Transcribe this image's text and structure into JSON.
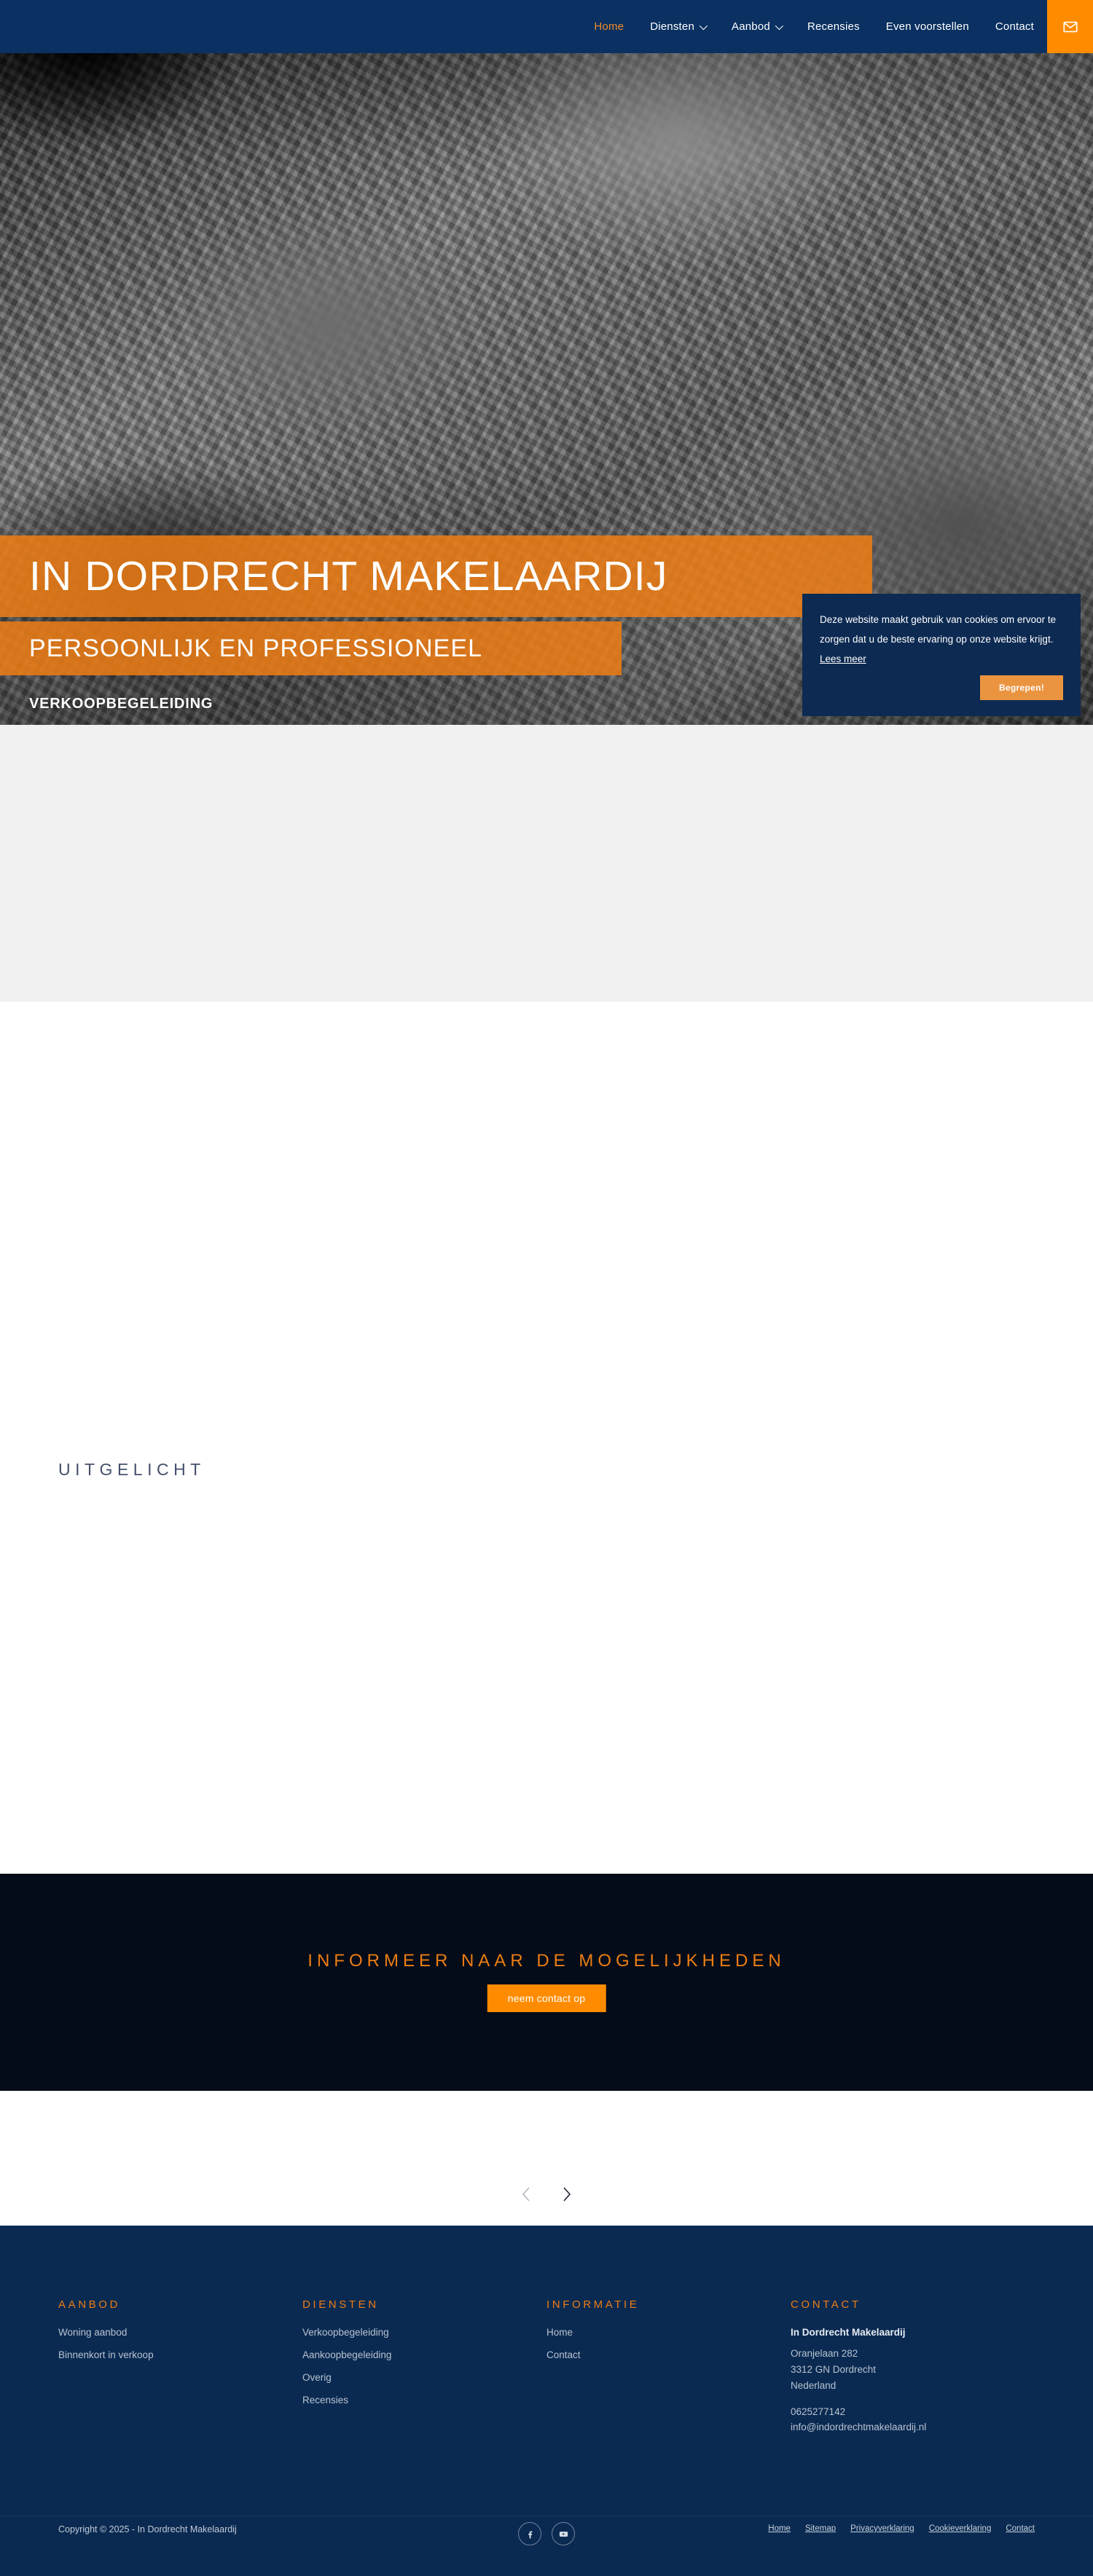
{
  "header": {
    "nav_items": [
      {
        "label": "Home",
        "active": true,
        "has_caret": false
      },
      {
        "label": "Diensten",
        "active": false,
        "has_caret": true
      },
      {
        "label": "Aanbod",
        "active": false,
        "has_caret": true
      },
      {
        "label": "Recensies",
        "active": false,
        "has_caret": false
      },
      {
        "label": "Even voorstellen",
        "active": false,
        "has_caret": false
      },
      {
        "label": "Contact",
        "active": false,
        "has_caret": false
      }
    ],
    "mail_icon": "mail-icon",
    "accent_color": "#ff8c00",
    "bar_color": "#0a3161"
  },
  "hero": {
    "title": "IN DORDRECHT MAKELAARDIJ",
    "subtitle": "PERSOONLIJK EN PROFESSIONEEL",
    "kicker": "VERKOOPBEGELEIDING",
    "bar_color": "#ed7d14"
  },
  "cookie": {
    "text": "Deze website maakt gebruik van cookies om ervoor te zorgen dat u de beste ervaring op onze website krijgt.",
    "link_label": "Lees meer",
    "button_label": "Begrepen!",
    "background": "#0c2a52",
    "button_color": "#eb9440"
  },
  "featured": {
    "heading": "UITGELICHT"
  },
  "cta": {
    "title": "INFORMEER NAAR DE MOGELIJKHEDEN",
    "button_label": "neem contact op",
    "background": "#030c18",
    "title_color": "#ed7d14",
    "button_color": "#ff8c00"
  },
  "carousel": {
    "prev_icon": "chevron-left-icon",
    "next_icon": "chevron-right-icon"
  },
  "footer": {
    "columns": [
      {
        "heading": "AANBOD",
        "links": [
          "Woning aanbod",
          "Binnenkort in verkoop"
        ]
      },
      {
        "heading": "DIENSTEN",
        "links": [
          "Verkoopbegeleiding",
          "Aankoopbegeleiding",
          "Overig",
          "Recensies"
        ]
      },
      {
        "heading": "INFORMATIE",
        "links": [
          "Home",
          "Contact"
        ]
      }
    ],
    "contact": {
      "heading": "CONTACT",
      "company": "In Dordrecht Makelaardij",
      "street": "Oranjelaan 282",
      "city": "3312 GN Dordrecht",
      "country": "Nederland",
      "phone": "0625277142",
      "email": "info@indordrechtmakelaardij.nl"
    },
    "heading_color": "#ed7d14",
    "background": "#0a2a52"
  },
  "bottom_bar": {
    "copyright": "Copyright © 2025 - In Dordrecht Makelaardij",
    "socials": [
      {
        "name": "facebook-icon"
      },
      {
        "name": "youtube-icon"
      }
    ],
    "links": [
      "Home",
      "Sitemap",
      "Privacyverklaring",
      "Cookieverklaring",
      "Contact"
    ]
  }
}
